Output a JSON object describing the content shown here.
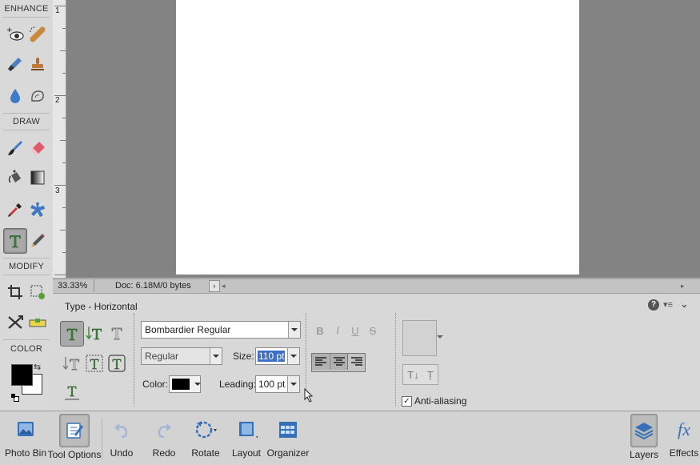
{
  "toolbox": {
    "sections": {
      "enhance": "ENHANCE",
      "draw": "DRAW",
      "modify": "MODIFY",
      "color": "COLOR"
    },
    "tools": [
      {
        "name": "red-eye-tool",
        "icon": "eye-icon"
      },
      {
        "name": "spot-healing-tool",
        "icon": "bandage-icon"
      },
      {
        "name": "smart-brush-tool",
        "icon": "smart-brush-icon"
      },
      {
        "name": "clone-stamp-tool",
        "icon": "stamp-icon"
      },
      {
        "name": "blur-tool",
        "icon": "drop-icon"
      },
      {
        "name": "sponge-tool",
        "icon": "sponge-icon"
      },
      {
        "name": "brush-tool",
        "icon": "brush-icon"
      },
      {
        "name": "eraser-tool",
        "icon": "eraser-icon"
      },
      {
        "name": "paint-bucket-tool",
        "icon": "bucket-icon"
      },
      {
        "name": "gradient-tool",
        "icon": "gradient-icon"
      },
      {
        "name": "eyedropper-tool",
        "icon": "eyedropper-icon"
      },
      {
        "name": "custom-shape-tool",
        "icon": "shape-icon"
      },
      {
        "name": "type-tool",
        "icon": "type-icon",
        "selected": true
      },
      {
        "name": "pencil-tool",
        "icon": "pencil-icon"
      },
      {
        "name": "crop-tool",
        "icon": "crop-icon"
      },
      {
        "name": "recompose-tool",
        "icon": "recompose-icon"
      },
      {
        "name": "content-aware-move-tool",
        "icon": "move-arrows-icon"
      },
      {
        "name": "straighten-tool",
        "icon": "level-icon"
      }
    ],
    "foreground_color": "#000000",
    "background_color": "#ffffff"
  },
  "ruler": {
    "marks": [
      "1",
      "2",
      "3"
    ]
  },
  "status": {
    "zoom": "33.33%",
    "doc_size": "Doc: 6.18M/0 bytes"
  },
  "tool_options": {
    "title": "Type - Horizontal",
    "font_family": "Bombardier Regular",
    "font_style": "Regular",
    "size_label": "Size:",
    "size_value": "110 pt",
    "color_label": "Color:",
    "text_color": "#000000",
    "leading_label": "Leading:",
    "leading_value": "100 pt",
    "style_buttons": [
      "B",
      "I",
      "U",
      "S"
    ],
    "anti_aliasing_label": "Anti-aliasing",
    "anti_aliasing_checked": true,
    "menu_icons": [
      "help-icon",
      "panel-menu-icon",
      "collapse-chevron-icon"
    ]
  },
  "bottom_bar": {
    "left": [
      {
        "name": "photo-bin",
        "label": "Photo Bin"
      },
      {
        "name": "tool-options",
        "label": "Tool Options",
        "selected": true
      },
      {
        "name": "undo",
        "label": "Undo"
      },
      {
        "name": "redo",
        "label": "Redo"
      },
      {
        "name": "rotate",
        "label": "Rotate"
      },
      {
        "name": "layout",
        "label": "Layout"
      },
      {
        "name": "organizer",
        "label": "Organizer"
      }
    ],
    "right": [
      {
        "name": "layers",
        "label": "Layers",
        "selected": true
      },
      {
        "name": "effects",
        "label": "Effects"
      }
    ]
  }
}
